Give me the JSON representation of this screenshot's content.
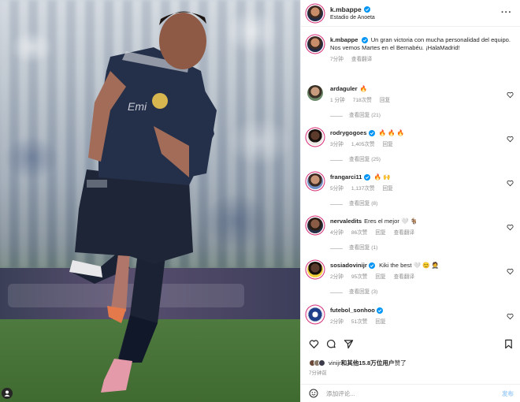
{
  "header": {
    "username": "k.mbappe",
    "location": "Estadio de Anoeta",
    "more_icon": "more-horizontal-icon"
  },
  "caption": {
    "username": "k.mbappe",
    "text": "Un gran victoria con mucha personalidad del equipo. Nos vemos Martes en el Bernabéu. ¡HalaMadrid!",
    "time": "7分钟",
    "translate": "查看翻译"
  },
  "comments": [
    {
      "username": "ardaguler",
      "verified": true,
      "text": "🔥",
      "time": "1 分钟",
      "likes": "718次赞",
      "reply": "回复",
      "replies": "查看回复 (21)"
    },
    {
      "username": "rodrygogoes",
      "verified": true,
      "text": "🔥 🔥 🔥",
      "time": "3分钟",
      "likes": "1,405次赞",
      "reply": "回复",
      "replies": "查看回复 (25)"
    },
    {
      "username": "frangarci11",
      "verified": true,
      "text": "🔥 🙌",
      "time": "5分钟",
      "likes": "1,137次赞",
      "reply": "回复",
      "replies": "查看回复 (8)"
    },
    {
      "username": "nervaledits",
      "verified": false,
      "text": "Eres el mejor 🤍 🐐",
      "time": "4分钟",
      "likes": "86次赞",
      "reply": "回复",
      "translate": "查看翻译",
      "replies": "查看回复 (1)"
    },
    {
      "username": "sosiadovinijr",
      "verified": true,
      "text": "Kiki the best 🤍 😊 🤵",
      "time": "2分钟",
      "likes": "95次赞",
      "reply": "回复",
      "translate": "查看翻译",
      "replies": "查看回复 (3)"
    },
    {
      "username": "futebol_sonhoo",
      "verified": true,
      "text": "",
      "time": "2分钟",
      "likes": "51次赞",
      "reply": "回复",
      "replies": ""
    }
  ],
  "likes_summary": {
    "user": "vinijr",
    "rest": "和其他15.8万位用户",
    "suffix": "赞了"
  },
  "post_time": "7分钟前",
  "comment_box": {
    "placeholder": "添加评论...",
    "post_label": "发布"
  },
  "colors": {
    "verified": "#0095f6",
    "story_ring": "#d62976",
    "post_button": "#a3cff8"
  }
}
